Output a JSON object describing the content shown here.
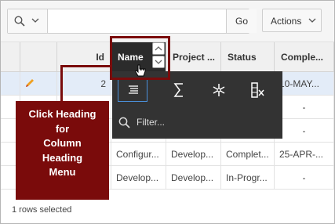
{
  "toolbar": {
    "search_icon": "magnifier-icon",
    "search_value": "",
    "go_label": "Go",
    "actions_label": "Actions"
  },
  "columns": [
    "Id",
    "Name",
    "Project ...",
    "Status",
    "Comple..."
  ],
  "rows": [
    {
      "id": "2",
      "name": "",
      "project": "",
      "status": "",
      "completed": "10-MAY..."
    },
    {
      "id": "",
      "name": "",
      "project": "",
      "status": "",
      "completed": "-"
    },
    {
      "id": "",
      "name": "",
      "project": "",
      "status": "",
      "completed": "-"
    },
    {
      "id": "",
      "name": "Configur...",
      "project": "Develop...",
      "status": "Complet...",
      "completed": "25-APR-..."
    },
    {
      "id": "",
      "name": "Develop...",
      "project": "Develop...",
      "status": "In-Progr...",
      "completed": "-"
    }
  ],
  "heading_menu": {
    "icons": [
      "align-left-icon",
      "sum-icon",
      "freeze-icon",
      "hide-column-icon"
    ],
    "filter_placeholder": "Filter..."
  },
  "callout": {
    "lines": [
      "Click Heading",
      "for",
      "Column",
      "Heading",
      "Menu"
    ]
  },
  "status_text": "1 rows selected",
  "colors": {
    "callout": "#7a0b0b",
    "menu_bg": "#333333",
    "selected_row": "#e3ecf8",
    "edit_pencil": "#f0a020"
  }
}
